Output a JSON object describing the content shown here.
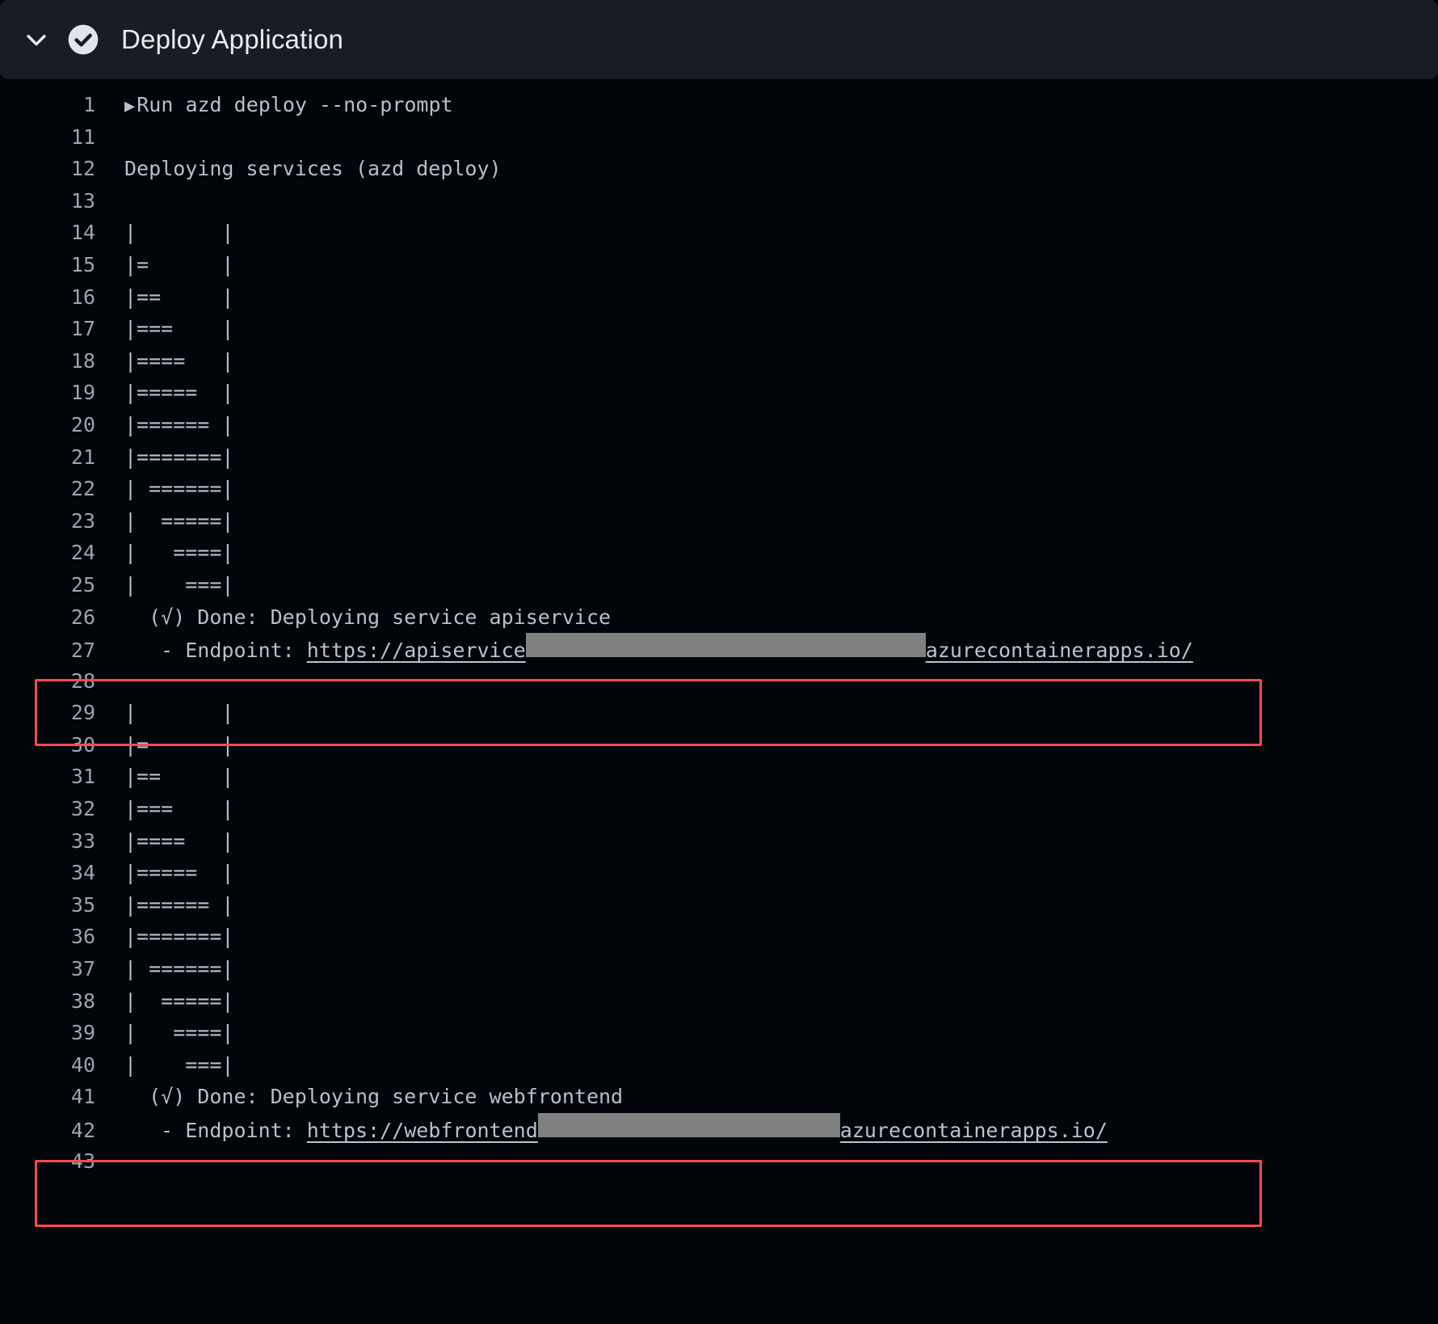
{
  "header": {
    "title": "Deploy Application",
    "chevron_icon": "chevron-down-icon",
    "status_icon": "check-circle-icon",
    "background": "#181c23",
    "title_color": "#e8ecf2"
  },
  "colors": {
    "background": "#02050a",
    "text": "#b6c0ce",
    "line_number": "#9aa5b3",
    "highlight_border": "#fa4a4f",
    "redaction": "#808080",
    "link": "#b9c3d1"
  },
  "log": {
    "lines": [
      {
        "n": "1",
        "type": "run",
        "text": "Run azd deploy --no-prompt",
        "caret": "▶"
      },
      {
        "n": "11",
        "type": "plain",
        "text": ""
      },
      {
        "n": "12",
        "type": "plain",
        "text": "Deploying services (azd deploy)"
      },
      {
        "n": "13",
        "type": "plain",
        "text": ""
      },
      {
        "n": "14",
        "type": "plain",
        "text": "|       |"
      },
      {
        "n": "15",
        "type": "plain",
        "text": "|=      |"
      },
      {
        "n": "16",
        "type": "plain",
        "text": "|==     |"
      },
      {
        "n": "17",
        "type": "plain",
        "text": "|===    |"
      },
      {
        "n": "18",
        "type": "plain",
        "text": "|====   |"
      },
      {
        "n": "19",
        "type": "plain",
        "text": "|=====  |"
      },
      {
        "n": "20",
        "type": "plain",
        "text": "|====== |"
      },
      {
        "n": "21",
        "type": "plain",
        "text": "|=======|"
      },
      {
        "n": "22",
        "type": "plain",
        "text": "| ======|"
      },
      {
        "n": "23",
        "type": "plain",
        "text": "|  =====|"
      },
      {
        "n": "24",
        "type": "plain",
        "text": "|   ====|"
      },
      {
        "n": "25",
        "type": "plain",
        "text": "|    ===|"
      },
      {
        "n": "26",
        "type": "plain",
        "text": "  (√) Done: Deploying service apiservice"
      },
      {
        "n": "27",
        "type": "endpoint",
        "prefix": "   - Endpoint: ",
        "url_head": "https://apiservice",
        "redaction": "api",
        "url_tail": "azurecontainerapps.io/"
      },
      {
        "n": "28",
        "type": "plain",
        "text": ""
      },
      {
        "n": "29",
        "type": "plain",
        "text": "|       |"
      },
      {
        "n": "30",
        "type": "plain",
        "text": "|=      |"
      },
      {
        "n": "31",
        "type": "plain",
        "text": "|==     |"
      },
      {
        "n": "32",
        "type": "plain",
        "text": "|===    |"
      },
      {
        "n": "33",
        "type": "plain",
        "text": "|====   |"
      },
      {
        "n": "34",
        "type": "plain",
        "text": "|=====  |"
      },
      {
        "n": "35",
        "type": "plain",
        "text": "|====== |"
      },
      {
        "n": "36",
        "type": "plain",
        "text": "|=======|"
      },
      {
        "n": "37",
        "type": "plain",
        "text": "| ======|"
      },
      {
        "n": "38",
        "type": "plain",
        "text": "|  =====|"
      },
      {
        "n": "39",
        "type": "plain",
        "text": "|   ====|"
      },
      {
        "n": "40",
        "type": "plain",
        "text": "|    ===|"
      },
      {
        "n": "41",
        "type": "plain",
        "text": "  (√) Done: Deploying service webfrontend"
      },
      {
        "n": "42",
        "type": "endpoint",
        "prefix": "   - Endpoint: ",
        "url_head": "https://webfrontend",
        "redaction": "web",
        "url_tail": "azurecontainerapps.io/"
      },
      {
        "n": "43",
        "type": "plain",
        "text": ""
      }
    ]
  },
  "highlights": [
    {
      "name": "apiservice-endpoint-highlight",
      "first_line": "26",
      "last_line": "27"
    },
    {
      "name": "webfrontend-endpoint-highlight",
      "first_line": "41",
      "last_line": "42"
    }
  ]
}
